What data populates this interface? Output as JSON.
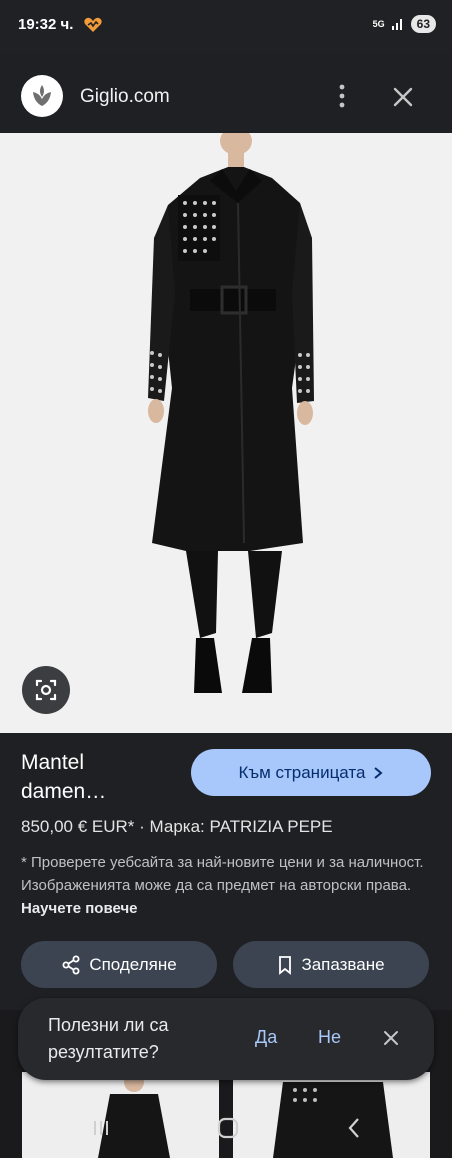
{
  "status": {
    "time": "19:32 ч.",
    "network": "5G",
    "battery": "63"
  },
  "header": {
    "site": "Giglio.com"
  },
  "product": {
    "title": "Mantel damen…",
    "goto_label": "Към страницата",
    "price_line": "850,00 € EUR* · Марка: PATRIZIA PEPE",
    "disclaimer": "* Проверете уебсайта за най-новите цени и за наличност. Изображенията може да са предмет на авторски права.",
    "learn_more": "Научете повече"
  },
  "actions": {
    "share_label": "Споделяне",
    "save_label": "Запазване"
  },
  "feedback": {
    "question": "Полезни ли са резултатите?",
    "yes": "Да",
    "no": "Не"
  },
  "colors": {
    "accent": "#a8c7fa",
    "background": "#1f2023",
    "button": "#3c4452"
  },
  "icons": [
    "giglio-logo-icon",
    "more-vert-icon",
    "close-icon",
    "lens-icon",
    "share-icon",
    "bookmark-icon",
    "chevron-right-icon",
    "recents-icon",
    "home-icon",
    "back-icon"
  ]
}
